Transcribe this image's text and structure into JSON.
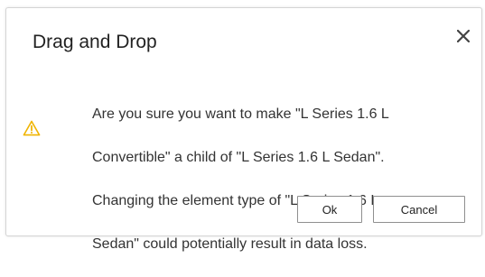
{
  "dialog": {
    "title": "Drag and Drop",
    "close_icon": "close-icon",
    "warning_icon": "warning-icon",
    "warning_color": "#f0b400",
    "message_lines": [
      "Are you sure you want to make \"L Series 1.6 L",
      "Convertible\" a child of \"L Series 1.6 L Sedan\".",
      "Changing the element type of \"L Series 1.6 L",
      "Sedan\" could potentially result in data loss."
    ],
    "buttons": {
      "ok_label": "Ok",
      "cancel_label": "Cancel"
    }
  }
}
